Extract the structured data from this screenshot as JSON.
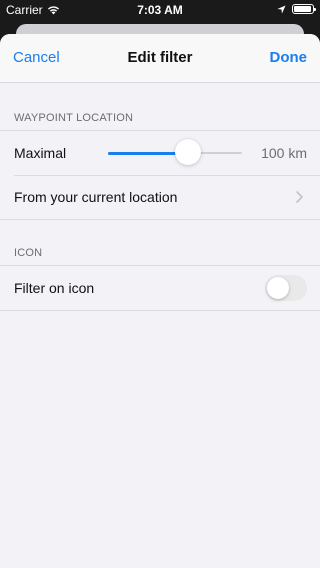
{
  "status_bar": {
    "carrier": "Carrier",
    "time": "7:03 AM"
  },
  "nav": {
    "cancel_label": "Cancel",
    "title": "Edit filter",
    "done_label": "Done"
  },
  "sections": {
    "waypoint_location": {
      "header": "WAYPOINT LOCATION",
      "maximal_label": "Maximal",
      "distance_value": "100 km",
      "slider_fraction": 0.6,
      "from_location_label": "From your current location"
    },
    "icon": {
      "header": "ICON",
      "filter_on_icon_label": "Filter on icon",
      "filter_on_icon_enabled": false
    }
  },
  "colors": {
    "accent": "#1a7ef2",
    "secondary_text": "#6d6d72"
  }
}
